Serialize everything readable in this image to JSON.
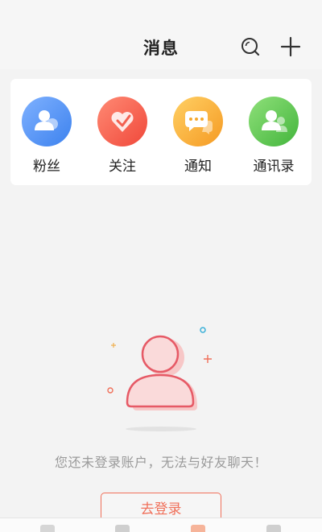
{
  "header": {
    "title": "消息",
    "search_icon": "search-icon",
    "add_icon": "plus-icon"
  },
  "shortcuts": [
    {
      "label": "粉丝",
      "icon": "fans-icon",
      "color": "#4a8df0"
    },
    {
      "label": "关注",
      "icon": "heart-icon",
      "color": "#f4574a"
    },
    {
      "label": "通知",
      "icon": "chat-bubble-icon",
      "color": "#f6a82c"
    },
    {
      "label": "通讯录",
      "icon": "contacts-icon",
      "color": "#52bd47"
    }
  ],
  "empty_state": {
    "message": "您还未登录账户，无法与好友聊天！",
    "illustration": "user-placeholder-icon"
  },
  "login_button": {
    "label": "去登录",
    "color": "#f0705a"
  },
  "tab_bar": {
    "icons": [
      "home-icon",
      "tab-icon-2",
      "tab-icon-3",
      "profile-icon"
    ]
  }
}
